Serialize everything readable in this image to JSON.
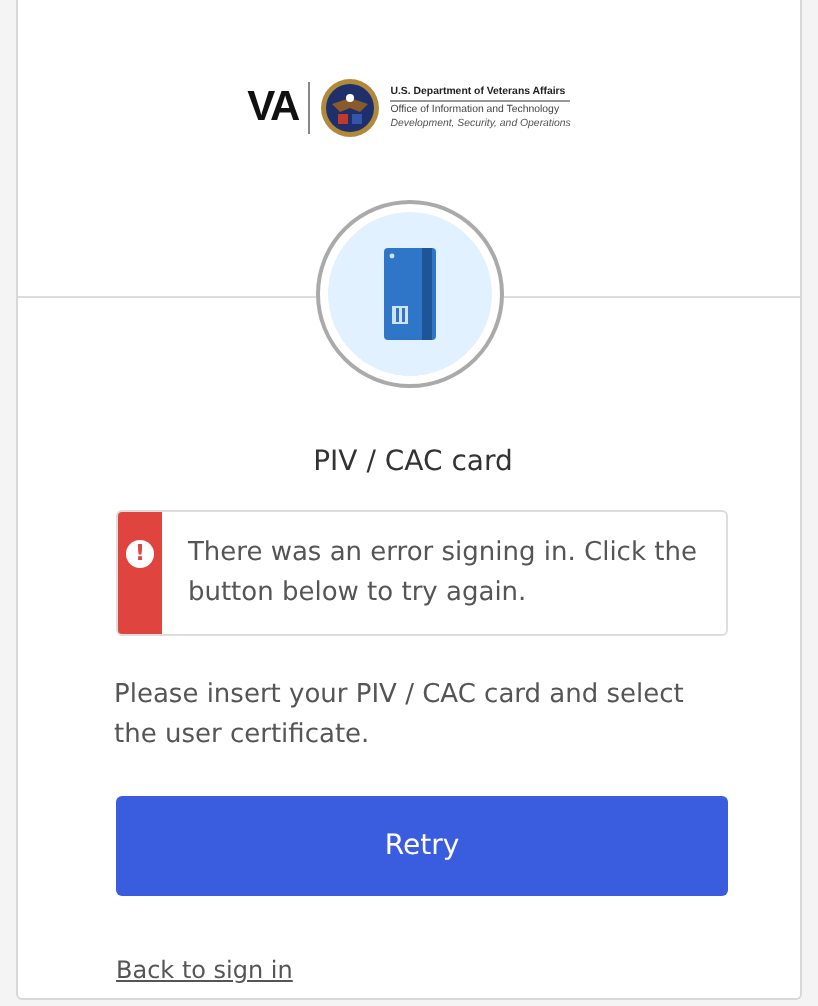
{
  "logo": {
    "mark": "VA",
    "department": "U.S. Department of Veterans Affairs",
    "office": "Office of Information and Technology",
    "division": "Development, Security, and Operations"
  },
  "title": "PIV / CAC card",
  "alert": {
    "kind": "error",
    "icon": "!",
    "message": "There was an error signing in. Click the button below to try again."
  },
  "instructions": "Please insert your PIV / CAC card and select the user certificate.",
  "primary_button": "Retry",
  "back_link": "Back to sign in"
}
